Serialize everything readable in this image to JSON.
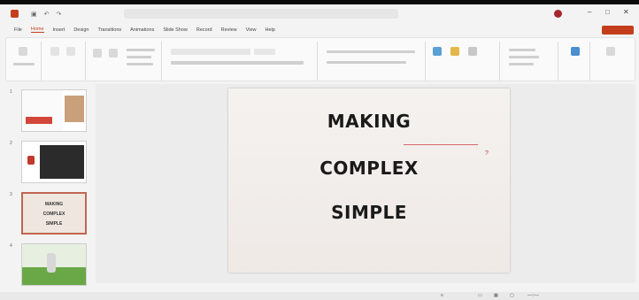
{
  "window": {
    "title": "",
    "search_placeholder": "",
    "user": ""
  },
  "ribbon": {
    "tabs": [
      "File",
      "Home",
      "Insert",
      "Design",
      "Transitions",
      "Animations",
      "Slide Show",
      "Record",
      "Review",
      "View",
      "Help"
    ],
    "active_tab_index": 1,
    "share_label": ""
  },
  "thumbnails": {
    "numbers": [
      "1",
      "2",
      "3",
      "4"
    ],
    "slide3_lines": [
      "MAKING",
      "COMPLEX",
      "SIMPLE"
    ]
  },
  "slide": {
    "header_left": "",
    "header_right": "",
    "lines": [
      "MAKING",
      "COMPLEX",
      "SIMPLE"
    ],
    "mark": "?"
  },
  "notes": {
    "placeholder": ""
  },
  "status": {
    "left": "",
    "zoom": ""
  },
  "colors": {
    "accent": "#c43e1c",
    "slide_accent_line": "#d46a6a"
  }
}
